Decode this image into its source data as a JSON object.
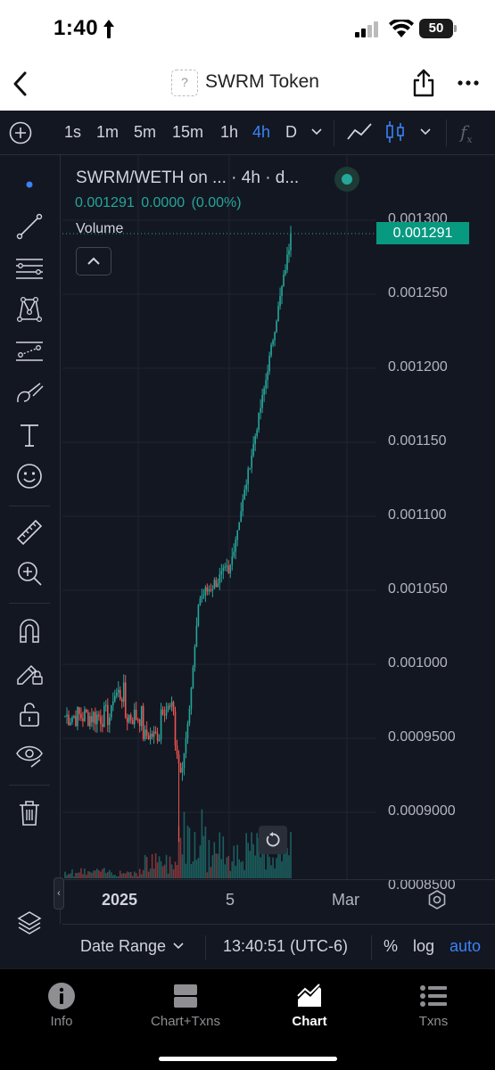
{
  "status": {
    "time": "1:40",
    "battery": "50",
    "battery_level_percent": 50
  },
  "header": {
    "title": "SWRM Token",
    "logo_placeholder": "?"
  },
  "toolbar": {
    "intervals": [
      "1s",
      "1m",
      "5m",
      "15m",
      "1h",
      "4h",
      "D"
    ],
    "active_interval": "4h",
    "fx_label": "f",
    "fx_sub": "x"
  },
  "legend": {
    "title": "SWRM/WETH on ... · 4h · d...",
    "price": "0.001291",
    "change": "0.0000",
    "change_pct": "(0.00%)",
    "volume_label": "Volume"
  },
  "price_axis": {
    "labels": [
      "0.001300",
      "0.001250",
      "0.001200",
      "0.001150",
      "0.001100",
      "0.001050",
      "0.001000",
      "0.0009500",
      "0.0009000",
      "0.0008500"
    ],
    "last_price": "0.001291"
  },
  "time_axis": {
    "labels": [
      "2025",
      "5",
      "Mar"
    ]
  },
  "bottom_bar": {
    "date_range": "Date Range",
    "clock": "13:40:51 (UTC-6)",
    "percent": "%",
    "log": "log",
    "auto": "auto"
  },
  "tabs": [
    {
      "label": "Info",
      "icon": "info-icon"
    },
    {
      "label": "Chart+Txns",
      "icon": "split-icon"
    },
    {
      "label": "Chart",
      "icon": "chart-icon",
      "active": true
    },
    {
      "label": "Txns",
      "icon": "list-icon"
    }
  ],
  "colors": {
    "up": "#26a69a",
    "down": "#ef5350",
    "background": "#131722",
    "accent": "#3b82f6"
  }
}
